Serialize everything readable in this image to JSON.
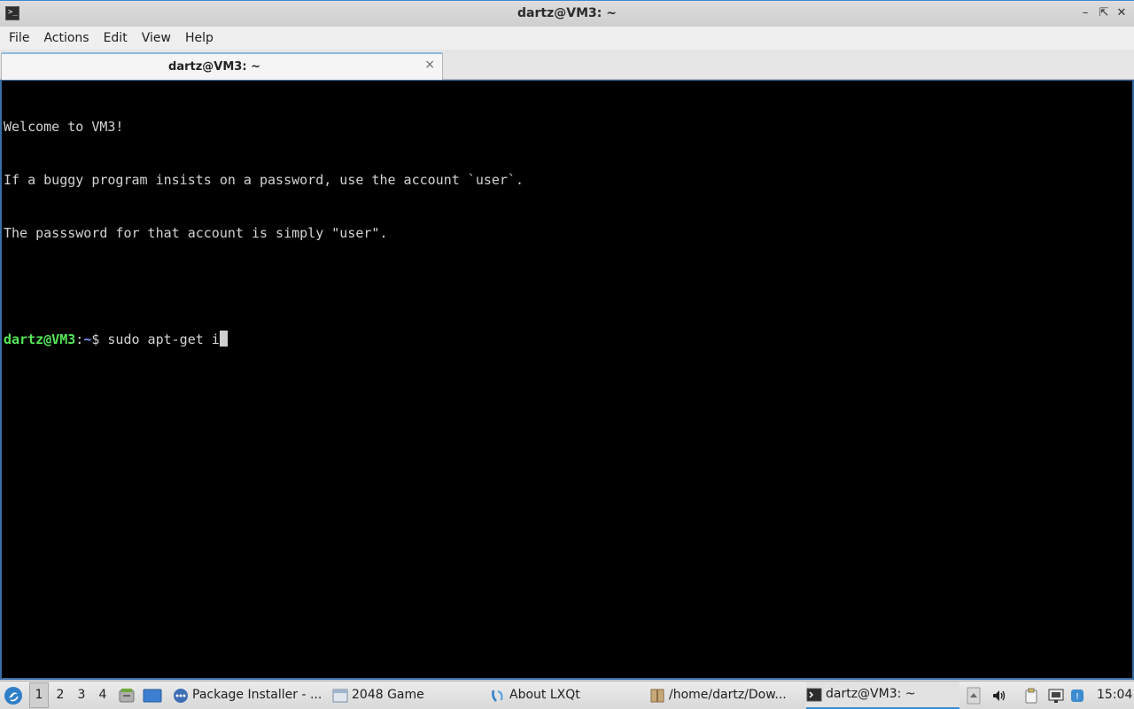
{
  "window": {
    "title": "dartz@VM3: ~",
    "icons": {
      "app": "terminal-icon",
      "minimize": "minimize-icon",
      "maximize": "maximize-icon",
      "close": "close-icon"
    }
  },
  "menu": {
    "items": [
      "File",
      "Actions",
      "Edit",
      "View",
      "Help"
    ]
  },
  "tabs": [
    {
      "label": "dartz@VM3: ~",
      "close": "×"
    }
  ],
  "terminal": {
    "welcome": [
      "Welcome to VM3!",
      "If a buggy program insists on a password, use the account `user`.",
      "The passsword for that account is simply \"user\"."
    ],
    "prompt": {
      "user_host": "dartz@VM3",
      "separator": ":",
      "path": "~",
      "symbol": "$ ",
      "command": "sudo apt-get i"
    },
    "colors": {
      "background": "#000000",
      "text": "#d3d3d3",
      "user_host": "#54e654",
      "path": "#7b9cff"
    }
  },
  "taskbar": {
    "workspaces": [
      "1",
      "2",
      "3",
      "4"
    ],
    "active_workspace": "1",
    "tasks": [
      {
        "label": "Package Installer - ...",
        "icon": "package-installer-icon"
      },
      {
        "label": "2048 Game",
        "icon": "window-icon"
      },
      {
        "label": "About LXQt",
        "icon": "lxqt-icon"
      },
      {
        "label": "/home/dartz/Dow...",
        "icon": "archive-icon"
      },
      {
        "label": "dartz@VM3: ~",
        "icon": "terminal-icon"
      }
    ],
    "clock": "15:04"
  }
}
